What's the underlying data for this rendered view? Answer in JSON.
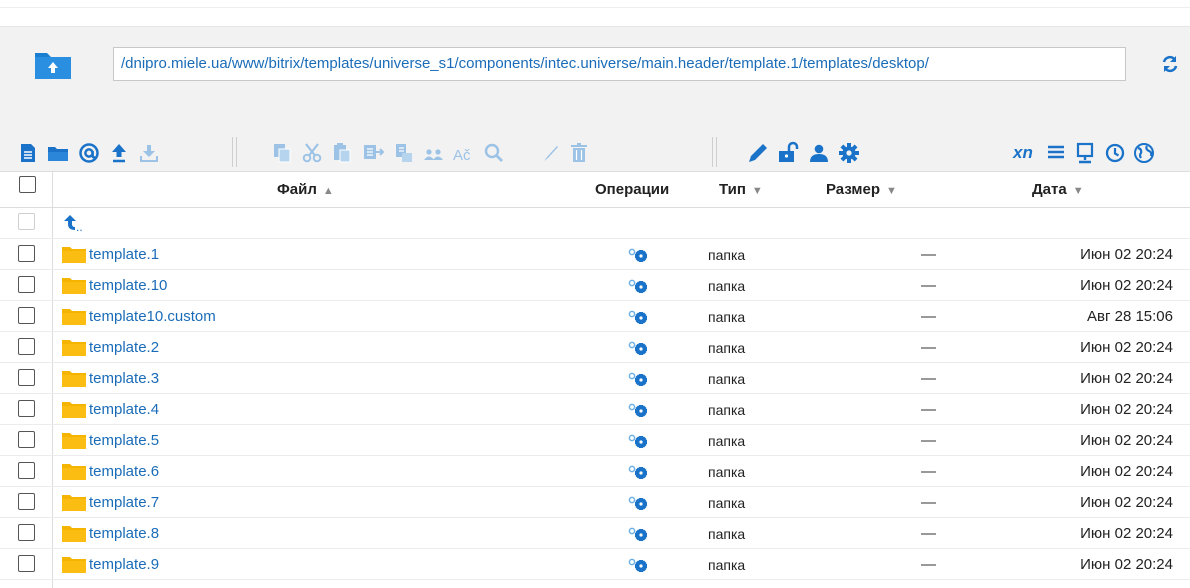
{
  "path": {
    "value": "/dnipro.miele.ua/www/bitrix/templates/universe_s1/components/intec.universe/main.header/template.1/templates/desktop/"
  },
  "toolbar": {
    "xn_label": "xn"
  },
  "table": {
    "headers": {
      "file": "Файл",
      "operations": "Операции",
      "type": "Тип",
      "size": "Размер",
      "date": "Дата"
    },
    "parent_label": "..",
    "rows": [
      {
        "name": "template.1",
        "type": "папка",
        "size": "—",
        "date": "Июн 02 20:24"
      },
      {
        "name": "template.10",
        "type": "папка",
        "size": "—",
        "date": "Июн 02 20:24"
      },
      {
        "name": "template10.custom",
        "type": "папка",
        "size": "—",
        "date": "Авг 28 15:06"
      },
      {
        "name": "template.2",
        "type": "папка",
        "size": "—",
        "date": "Июн 02 20:24"
      },
      {
        "name": "template.3",
        "type": "папка",
        "size": "—",
        "date": "Июн 02 20:24"
      },
      {
        "name": "template.4",
        "type": "папка",
        "size": "—",
        "date": "Июн 02 20:24"
      },
      {
        "name": "template.5",
        "type": "папка",
        "size": "—",
        "date": "Июн 02 20:24"
      },
      {
        "name": "template.6",
        "type": "папка",
        "size": "—",
        "date": "Июн 02 20:24"
      },
      {
        "name": "template.7",
        "type": "папка",
        "size": "—",
        "date": "Июн 02 20:24"
      },
      {
        "name": "template.8",
        "type": "папка",
        "size": "—",
        "date": "Июн 02 20:24"
      },
      {
        "name": "template.9",
        "type": "папка",
        "size": "—",
        "date": "Июн 02 20:24"
      }
    ]
  },
  "colors": {
    "accent": "#1a73c9",
    "link": "#1a6cb8",
    "folder": "#f5b400",
    "disabled": "#9cc3e6"
  },
  "icons": [
    "folder-up-icon",
    "refresh-icon",
    "new-file-icon",
    "new-folder-icon",
    "at-icon",
    "upload-icon",
    "download-icon",
    "copy-icon",
    "cut-icon",
    "paste-icon",
    "move-icon",
    "duplicate-icon",
    "users-icon",
    "spellcheck-icon",
    "search-icon",
    "edit-text-icon",
    "delete-icon",
    "rename-icon",
    "unlock-icon",
    "user-icon",
    "settings-icon",
    "list-view-icon",
    "monitor-icon",
    "history-icon",
    "globe-icon",
    "operations-gear-icon",
    "folder-icon",
    "parent-arrow-icon"
  ]
}
